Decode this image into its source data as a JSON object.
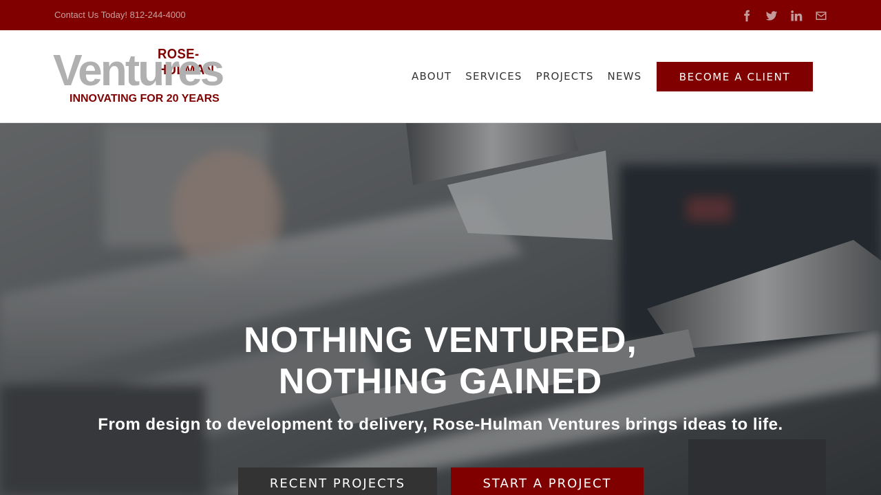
{
  "topbar": {
    "contact": "Contact Us Today! 812-244-4000",
    "social": [
      "facebook-icon",
      "twitter-icon",
      "linkedin-icon",
      "mail-icon"
    ],
    "color": "#800000"
  },
  "logo": {
    "top": "ROSE-HULMAN",
    "main": "Ventures",
    "sub": "INNOVATING FOR 20 YEARS"
  },
  "nav": {
    "items": [
      "ABOUT",
      "SERVICES",
      "PROJECTS",
      "NEWS"
    ],
    "cta": "BECOME A CLIENT"
  },
  "hero": {
    "title_line1": "NOTHING VENTURED,",
    "title_line2": "NOTHING GAINED",
    "subtitle": "From design to development to delivery, Rose-Hulman Ventures brings ideas to life.",
    "btn_recent": "RECENT PROJECTS",
    "btn_start": "START A PROJECT"
  },
  "colors": {
    "brand": "#800000",
    "dark_button": "#333333",
    "logo_gray": "#b0b0b0"
  }
}
